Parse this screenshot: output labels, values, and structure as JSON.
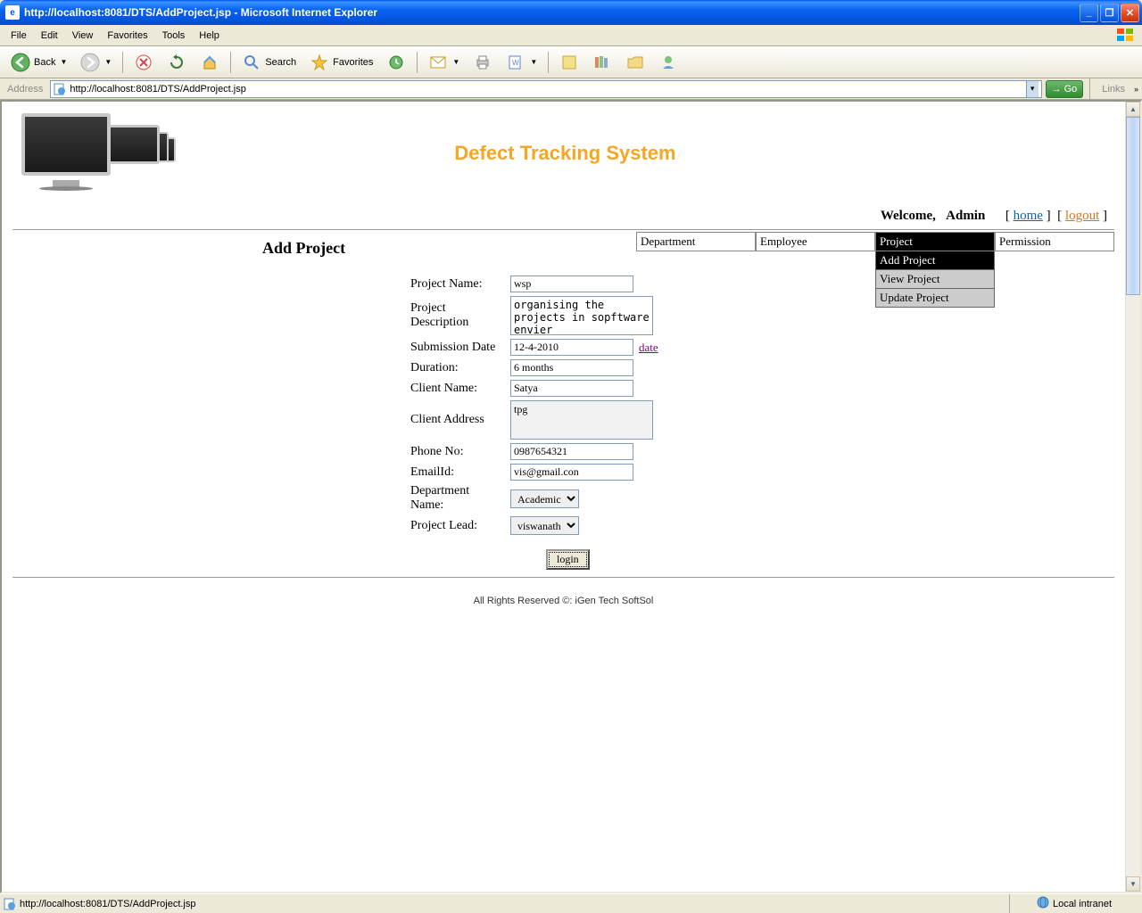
{
  "window": {
    "title": "http://localhost:8081/DTS/AddProject.jsp - Microsoft Internet Explorer"
  },
  "menubar": [
    "File",
    "Edit",
    "View",
    "Favorites",
    "Tools",
    "Help"
  ],
  "toolbar": {
    "back": "Back",
    "search": "Search",
    "favorites": "Favorites"
  },
  "addressbar": {
    "label": "Address",
    "url": "http://localhost:8081/DTS/AddProject.jsp",
    "go": "Go",
    "links": "Links"
  },
  "page": {
    "title": "Defect Tracking System",
    "welcome": "Welcome,",
    "user": "Admin",
    "home": "home",
    "logout": "logout",
    "formtitle": "Add Project",
    "nav": {
      "department": "Department",
      "employee": "Employee",
      "project": "Project",
      "permission": "Permission",
      "sub": {
        "add": "Add Project",
        "view": "View Project",
        "update": "Update Project"
      }
    },
    "form": {
      "projectName": {
        "label": "Project Name:",
        "value": "wsp"
      },
      "projectDesc": {
        "label": "Project Description",
        "value": "organising the projects in sopftware envier"
      },
      "submission": {
        "label": "Submission Date",
        "value": "12-4-2010",
        "link": "date"
      },
      "duration": {
        "label": "Duration:",
        "value": "6 months"
      },
      "clientName": {
        "label": "Client Name:",
        "value": "Satya"
      },
      "clientAddr": {
        "label": "Client Address",
        "value": "tpg"
      },
      "phone": {
        "label": "Phone No:",
        "value": "0987654321"
      },
      "email": {
        "label": "EmailId:",
        "value": "vis@gmail.con"
      },
      "dept": {
        "label": "Department Name:",
        "value": "Academic"
      },
      "lead": {
        "label": "Project Lead:",
        "value": "viswanath"
      },
      "submit": "login"
    },
    "footer": "All Rights Reserved ©: iGen Tech SoftSol"
  },
  "statusbar": {
    "text": "http://localhost:8081/DTS/AddProject.jsp",
    "zone": "Local intranet"
  }
}
